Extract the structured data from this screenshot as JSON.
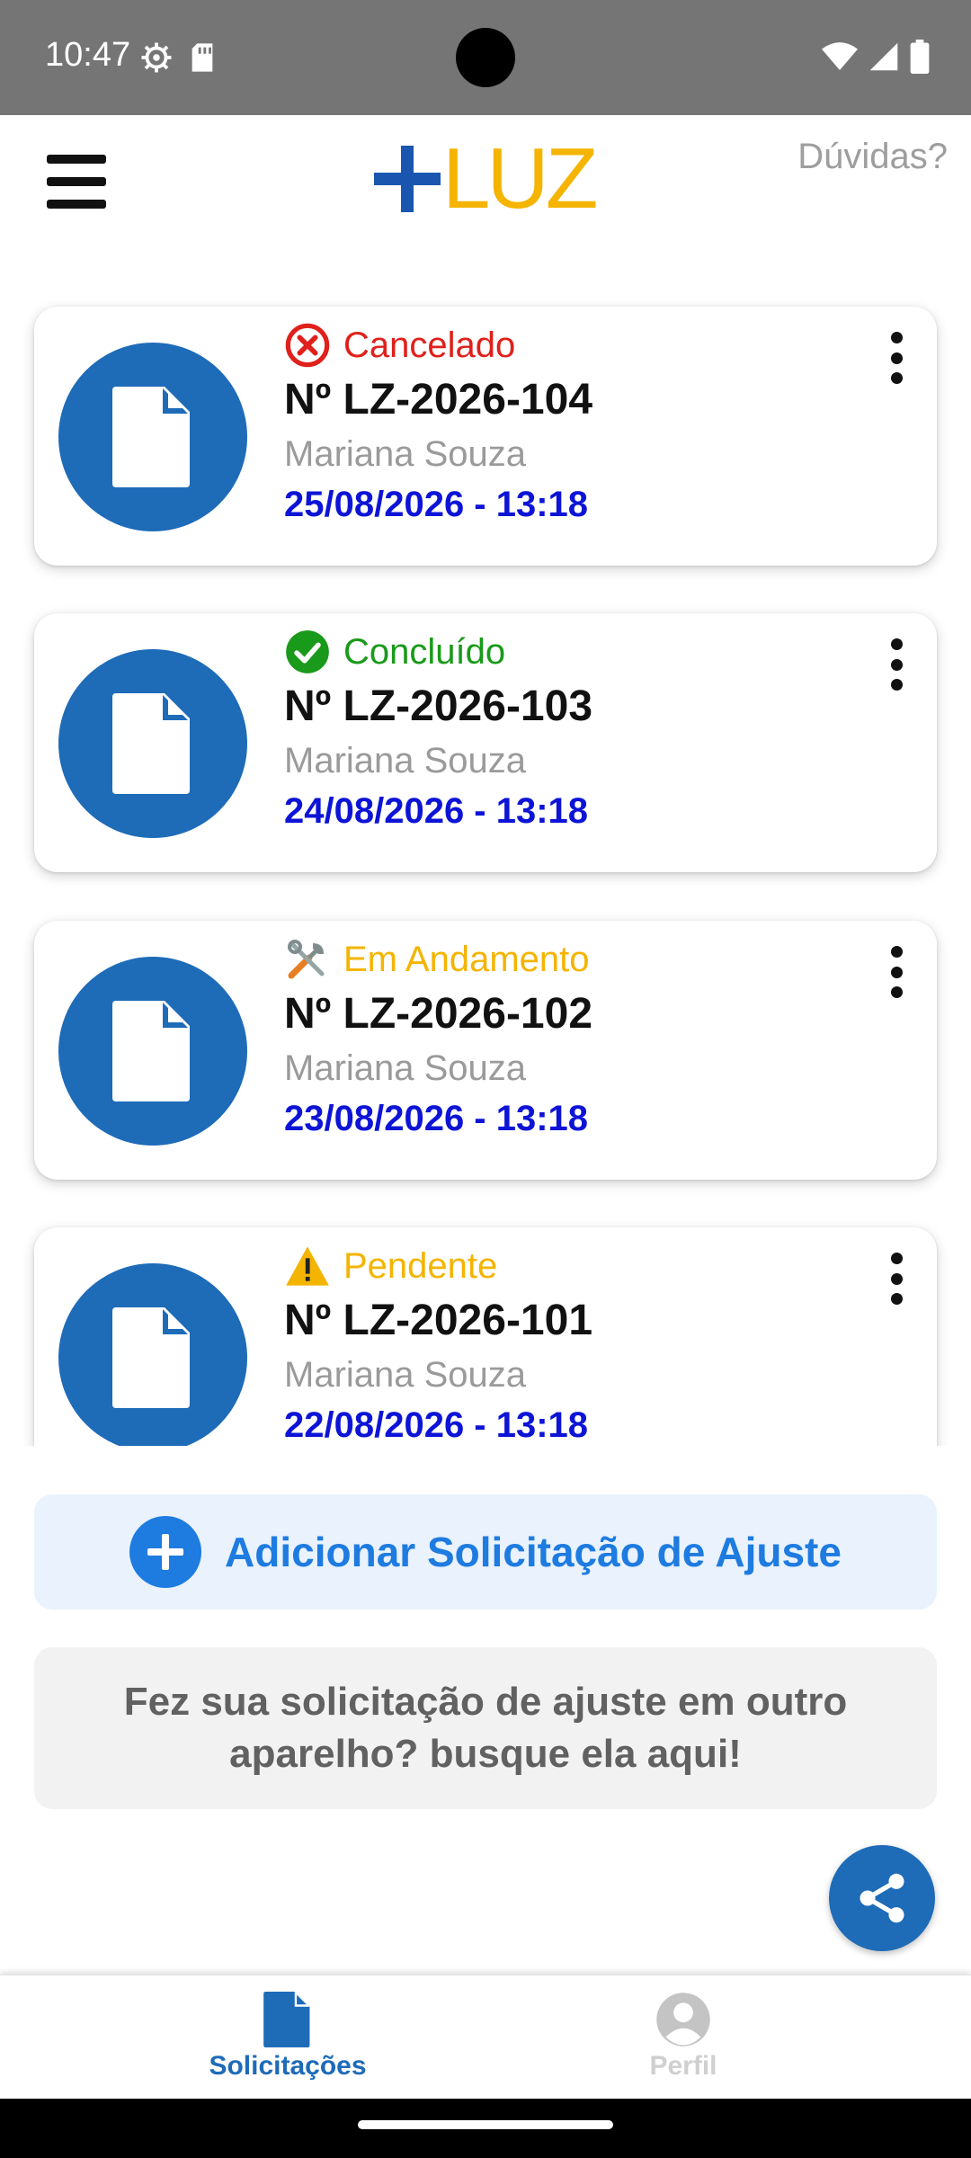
{
  "status_bar": {
    "time": "10:47",
    "left_icons": [
      "settings-icon",
      "sd-card-icon"
    ],
    "right_icons": [
      "wifi-icon",
      "signal-icon",
      "battery-icon"
    ]
  },
  "header": {
    "logo_plus": "+",
    "logo_text": "LUZ",
    "help_label": "Dúvidas?",
    "menu_icon": "hamburger-menu-icon"
  },
  "colors": {
    "brand_blue": "#1e6bb8",
    "logo_yellow": "#f4b400",
    "canceled": "#e0201b",
    "completed": "#1a9a1a",
    "in_progress": "#f4b400",
    "pending": "#f4b400",
    "date_blue": "#0d14d6"
  },
  "requests": [
    {
      "status": "Cancelado",
      "status_icon": "cancel-circle-icon",
      "number": "Nº LZ-2026-104",
      "name": "Mariana Souza",
      "date": "25/08/2026 - 13:18"
    },
    {
      "status": "Concluído",
      "status_icon": "check-circle-icon",
      "number": "Nº LZ-2026-103",
      "name": "Mariana Souza",
      "date": "24/08/2026 - 13:18"
    },
    {
      "status": "Em Andamento",
      "status_icon": "tools-icon",
      "number": "Nº LZ-2026-102",
      "name": "Mariana Souza",
      "date": "23/08/2026 - 13:18"
    },
    {
      "status": "Pendente",
      "status_icon": "warning-icon",
      "number": "Nº LZ-2026-101",
      "name": "Mariana Souza",
      "date": "22/08/2026 - 13:18"
    }
  ],
  "actions": {
    "add_label": "Adicionar Solicitação de Ajuste",
    "search_other_label": "Fez sua solicitação de ajuste em outro aparelho? busque ela aqui!"
  },
  "bottom_nav": {
    "items": [
      {
        "label": "Solicitações",
        "icon": "document-icon",
        "active": true
      },
      {
        "label": "Perfil",
        "icon": "profile-icon",
        "active": false
      }
    ]
  }
}
